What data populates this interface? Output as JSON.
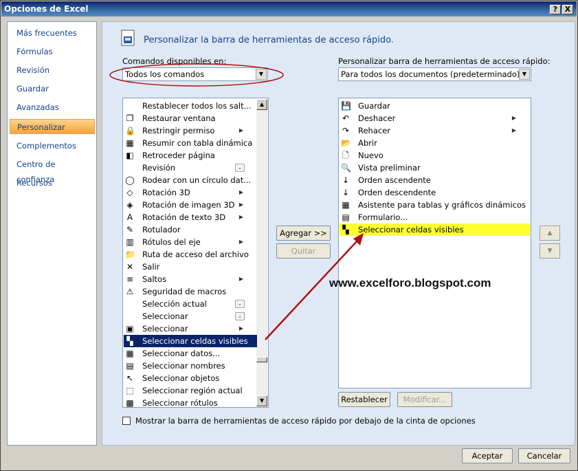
{
  "window": {
    "title": "Opciones de Excel",
    "help_label": "?",
    "close_label": "X"
  },
  "nav": {
    "items": [
      "Más frecuentes",
      "Fórmulas",
      "Revisión",
      "Guardar",
      "Avanzadas",
      "Personalizar",
      "Complementos",
      "Centro de confianza",
      "Recursos"
    ],
    "selected": "Personalizar"
  },
  "header": {
    "title": "Personalizar la barra de herramientas de acceso rápido."
  },
  "commands": {
    "label": "Comandos disponibles en:",
    "value": "Todos los comandos",
    "items": [
      {
        "label": "Restablecer todos los salt...",
        "icon": "blank-icon"
      },
      {
        "label": "Restaurar ventana",
        "icon": "window-restore-icon"
      },
      {
        "label": "Restringir permiso",
        "icon": "permission-icon",
        "sub": "▶"
      },
      {
        "label": "Resumir con tabla dinámica",
        "icon": "pivot-table-icon"
      },
      {
        "label": "Retroceder página",
        "icon": "page-back-icon"
      },
      {
        "label": "Revisión",
        "icon": "blank-icon",
        "dd": "⌄"
      },
      {
        "label": "Rodear con un círculo dat...",
        "icon": "circle-data-icon"
      },
      {
        "label": "Rotación 3D",
        "icon": "rotate-3d-icon",
        "sub": "▶"
      },
      {
        "label": "Rotación de imagen 3D",
        "icon": "rotate-image-icon",
        "sub": "▶"
      },
      {
        "label": "Rotación de texto 3D",
        "icon": "rotate-text-icon",
        "sub": "▶"
      },
      {
        "label": "Rotulador",
        "icon": "marker-icon"
      },
      {
        "label": "Rótulos del eje",
        "icon": "axis-labels-icon",
        "sub": "▶"
      },
      {
        "label": "Ruta de acceso del archivo",
        "icon": "folder-path-icon"
      },
      {
        "label": "Salir",
        "icon": "exit-icon"
      },
      {
        "label": "Saltos",
        "icon": "breaks-icon",
        "sub": "▶"
      },
      {
        "label": "Seguridad de macros",
        "icon": "warning-icon"
      },
      {
        "label": "Selección actual",
        "icon": "blank-icon",
        "dd": "⌄"
      },
      {
        "label": "Seleccionar",
        "icon": "blank-icon",
        "dd": "⌄"
      },
      {
        "label": "Seleccionar",
        "icon": "select-icon",
        "sub": "▶"
      },
      {
        "label": "Seleccionar celdas visibles",
        "icon": "visible-cells-icon",
        "selected": true
      },
      {
        "label": "Seleccionar datos...",
        "icon": "select-data-icon"
      },
      {
        "label": "Seleccionar nombres",
        "icon": "select-names-icon"
      },
      {
        "label": "Seleccionar objetos",
        "icon": "cursor-icon"
      },
      {
        "label": "Seleccionar región actual",
        "icon": "region-icon"
      },
      {
        "label": "Seleccionar rótulos",
        "icon": "labels-select-icon"
      }
    ]
  },
  "toolbar": {
    "label": "Personalizar barra de herramientas de acceso rápido:",
    "value": "Para todos los documentos (predeterminado)",
    "items": [
      {
        "label": "Guardar",
        "icon": "save-icon"
      },
      {
        "label": "Deshacer",
        "icon": "undo-icon",
        "sub": "▶"
      },
      {
        "label": "Rehacer",
        "icon": "redo-icon",
        "sub": "▶"
      },
      {
        "label": "Abrir",
        "icon": "open-folder-icon"
      },
      {
        "label": "Nuevo",
        "icon": "new-document-icon"
      },
      {
        "label": "Vista preliminar",
        "icon": "print-preview-icon"
      },
      {
        "label": "Orden ascendente",
        "icon": "sort-asc-icon"
      },
      {
        "label": "Orden descendente",
        "icon": "sort-desc-icon"
      },
      {
        "label": "Asistente para tablas y gráficos dinámicos",
        "icon": "pivot-wizard-icon"
      },
      {
        "label": "Formulario...",
        "icon": "form-icon"
      },
      {
        "label": "Seleccionar celdas visibles",
        "icon": "visible-cells-icon",
        "highlight": true
      }
    ]
  },
  "buttons": {
    "add": "Agregar >>",
    "remove": "Quitar",
    "reset": "Restablecer",
    "modify": "Modificar...",
    "up": "▲",
    "down": "▼",
    "ok": "Aceptar",
    "cancel": "Cancelar"
  },
  "watermark": "www.excelforo.blogspot.com",
  "checkbox": {
    "label": "Mostrar la barra de herramientas de acceso rápido por debajo de la cinta de opciones",
    "checked": false
  },
  "colors": {
    "selection": "#0a246a",
    "highlight": "#ffff33",
    "annotation": "#b01010"
  }
}
